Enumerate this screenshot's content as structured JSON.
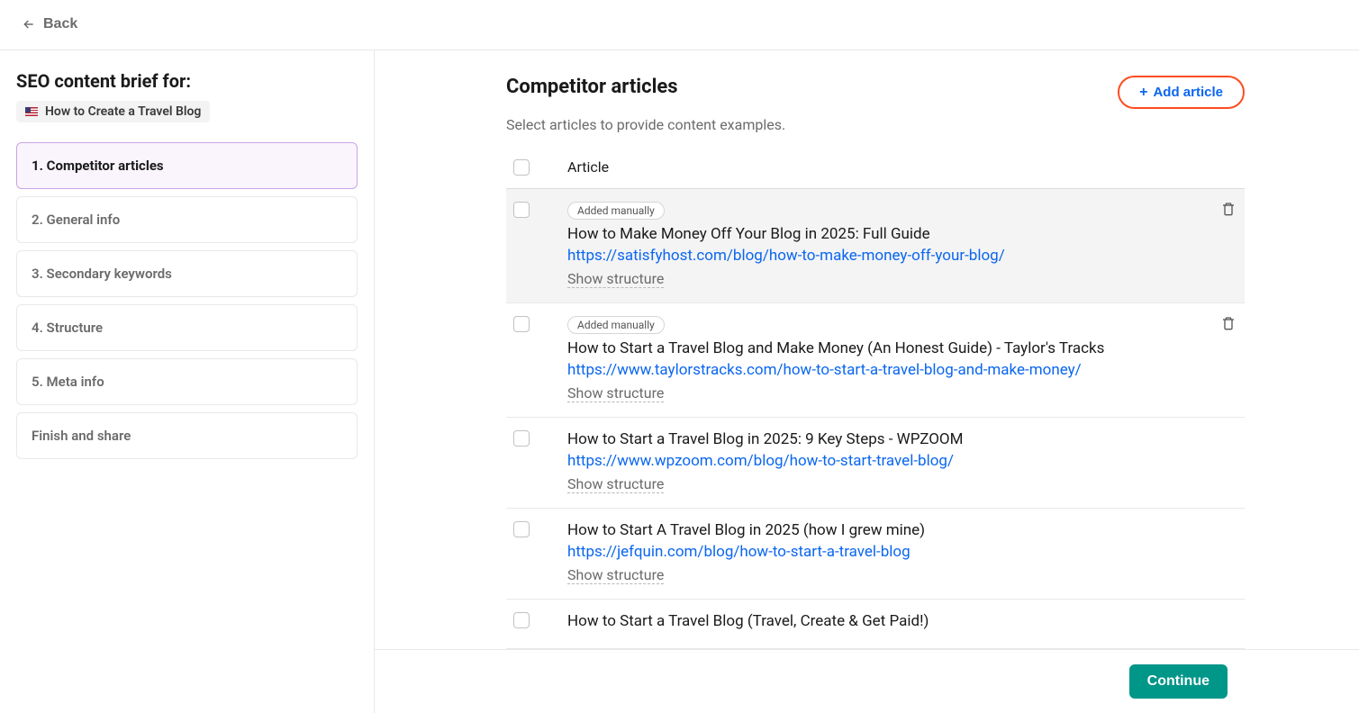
{
  "header": {
    "back_label": "Back"
  },
  "sidebar": {
    "brief_title": "SEO content brief for:",
    "topic": "How to Create a Travel Blog",
    "steps": [
      {
        "label": "1. Competitor articles",
        "active": true
      },
      {
        "label": "2. General info",
        "active": false
      },
      {
        "label": "3. Secondary keywords",
        "active": false
      },
      {
        "label": "4. Structure",
        "active": false
      },
      {
        "label": "5. Meta info",
        "active": false
      },
      {
        "label": "Finish and share",
        "active": false
      }
    ]
  },
  "main": {
    "title": "Competitor articles",
    "subtitle": "Select articles to provide content examples.",
    "add_article_label": "Add article",
    "table_head": "Article",
    "badge_manual": "Added manually",
    "show_structure": "Show structure",
    "continue_label": "Continue",
    "articles": [
      {
        "manual": true,
        "hover": true,
        "trash": true,
        "title": "How to Make Money Off Your Blog in 2025: Full Guide",
        "url": "https://satisfyhost.com/blog/how-to-make-money-off-your-blog/",
        "show_structure": true
      },
      {
        "manual": true,
        "hover": false,
        "trash": true,
        "title": "How to Start a Travel Blog and Make Money (An Honest Guide) - Taylor's Tracks",
        "url": "https://www.taylorstracks.com/how-to-start-a-travel-blog-and-make-money/",
        "show_structure": true
      },
      {
        "manual": false,
        "hover": false,
        "trash": false,
        "title": "How to Start a Travel Blog in 2025: 9 Key Steps - WPZOOM",
        "url": "https://www.wpzoom.com/blog/how-to-start-travel-blog/",
        "show_structure": true
      },
      {
        "manual": false,
        "hover": false,
        "trash": false,
        "title": "How to Start A Travel Blog in 2025 (how I grew mine)",
        "url": "https://jefquin.com/blog/how-to-start-a-travel-blog",
        "show_structure": true
      },
      {
        "manual": false,
        "hover": false,
        "trash": false,
        "title": "How to Start a Travel Blog (Travel, Create & Get Paid!)",
        "url": "",
        "show_structure": false
      }
    ]
  }
}
